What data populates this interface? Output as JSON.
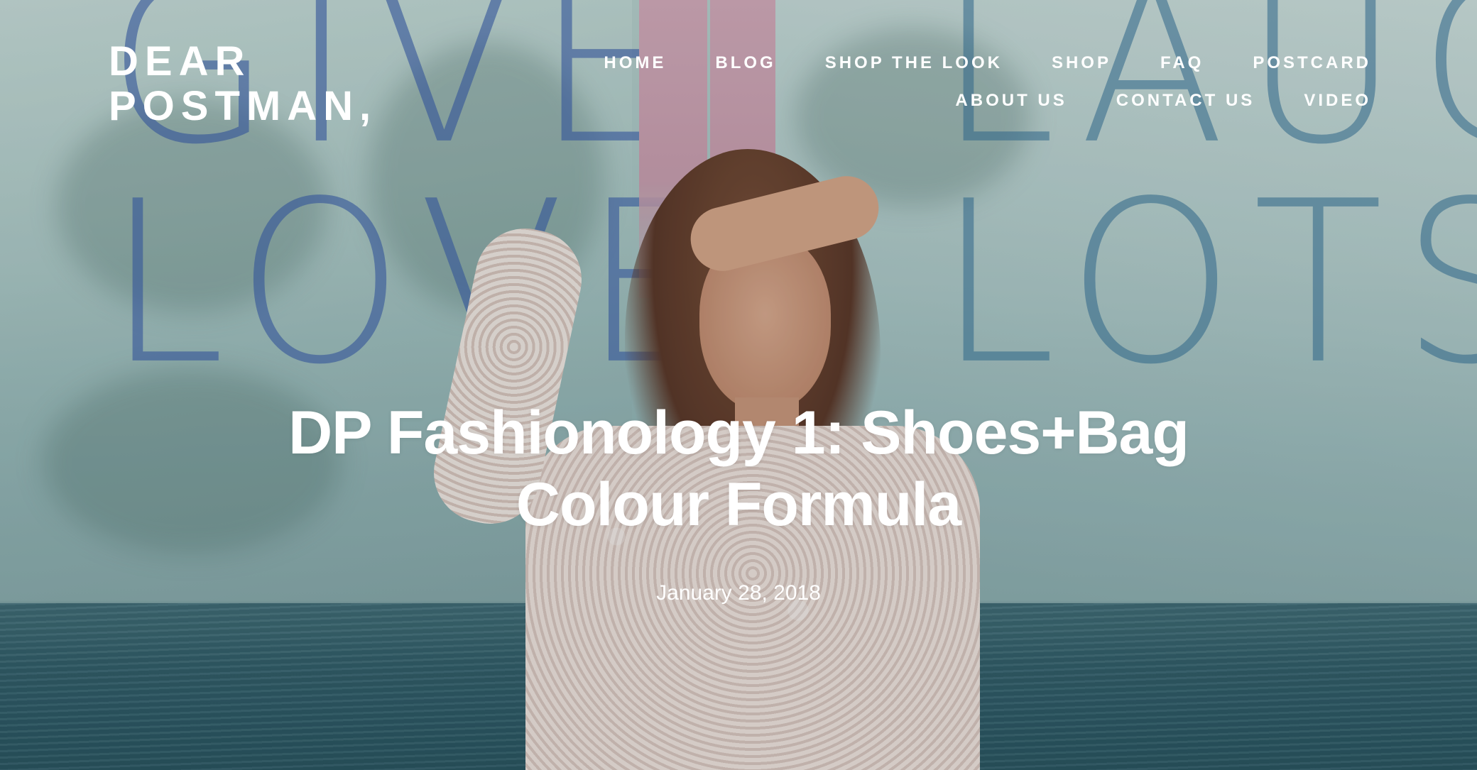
{
  "site": {
    "logo_line1": "DEAR",
    "logo_line2": "POSTMAN,"
  },
  "nav": {
    "row1": [
      {
        "label": "HOME"
      },
      {
        "label": "BLOG"
      },
      {
        "label": "SHOP THE LOOK"
      },
      {
        "label": "SHOP"
      },
      {
        "label": "FAQ"
      },
      {
        "label": "POSTCARD"
      }
    ],
    "row2": [
      {
        "label": "ABOUT US"
      },
      {
        "label": "CONTACT US"
      },
      {
        "label": "VIDEO"
      }
    ]
  },
  "post": {
    "title_line1": "DP Fashionology 1: Shoes+Bag",
    "title_line2": "Colour Formula",
    "date": "January 28, 2018"
  },
  "hero": {
    "window_text_left_line1": "GIVE",
    "window_text_left_line2": "LOVE",
    "window_text_right_line1": "LAUGH",
    "window_text_right_line2": "LOTS"
  },
  "colors": {
    "text": "#ffffff",
    "window_text_left": "#3a5caa",
    "window_text_right": "#326e96",
    "pillar": "#d3a8b8",
    "sea": "#325e6a"
  }
}
